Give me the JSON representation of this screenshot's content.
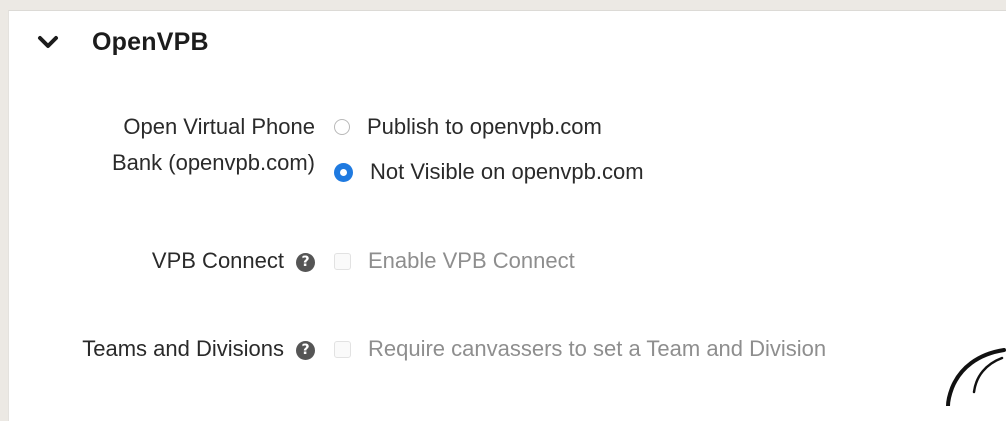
{
  "section": {
    "title": "OpenVPB",
    "expanded": true,
    "icon": "chevron-down-icon"
  },
  "open_vpb": {
    "label": "Open Virtual Phone Bank (openvpb.com)",
    "options": [
      {
        "label": "Publish to openvpb.com",
        "selected": false
      },
      {
        "label": "Not Visible on openvpb.com",
        "selected": true
      }
    ]
  },
  "vpb_connect": {
    "label": "VPB Connect",
    "help_icon": "question-circle-icon",
    "help_glyph": "?",
    "checkbox_label": "Enable VPB Connect",
    "checked": false,
    "disabled": true
  },
  "teams_divisions": {
    "label": "Teams and Divisions",
    "help_icon": "question-circle-icon",
    "help_glyph": "?",
    "checkbox_label": "Require canvassers to set a Team and Division",
    "checked": false,
    "disabled": true
  },
  "colors": {
    "accent": "#1f7ae0",
    "text": "#2a2a2a",
    "disabled_text": "#8e8e8e"
  }
}
